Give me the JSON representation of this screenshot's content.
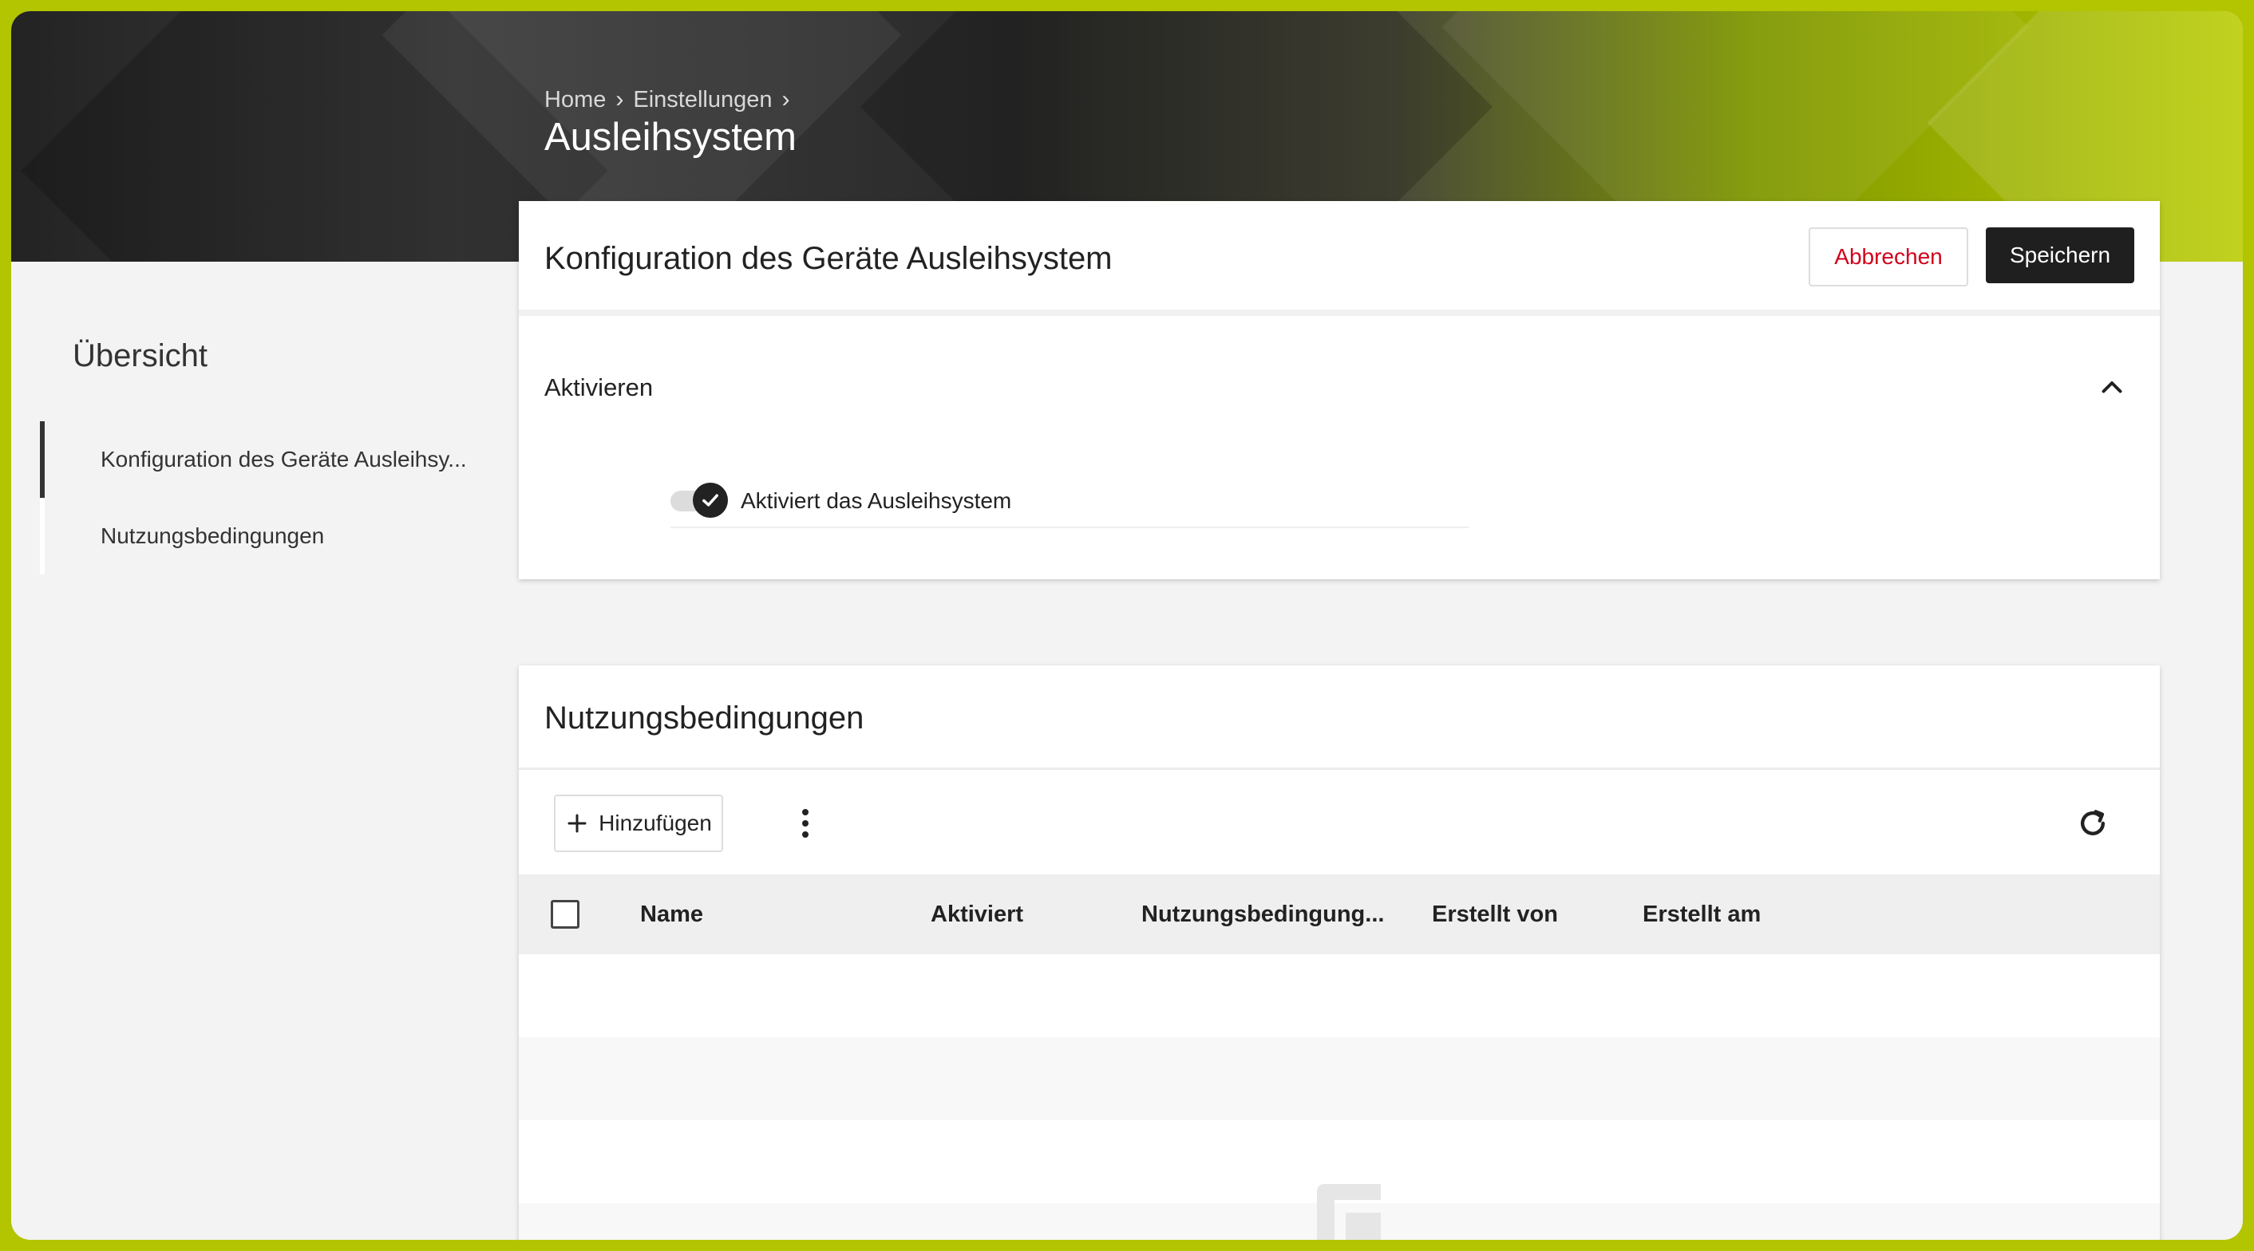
{
  "header": {
    "breadcrumb": [
      "Home",
      "Einstellungen"
    ],
    "title": "Ausleihsystem"
  },
  "sidebar": {
    "title": "Übersicht",
    "items": [
      {
        "label": "Konfiguration des Geräte Ausleihsy...",
        "active": true
      },
      {
        "label": "Nutzungsbedingungen",
        "active": false
      }
    ]
  },
  "config": {
    "title": "Konfiguration des Geräte Ausleihsystem",
    "cancel_label": "Abbrechen",
    "save_label": "Speichern",
    "section_label": "Aktivieren",
    "toggle_label": "Aktiviert das Ausleihsystem",
    "toggle_on": true
  },
  "terms": {
    "title": "Nutzungsbedingungen",
    "add_label": "Hinzufügen",
    "columns": [
      "Name",
      "Aktiviert",
      "Nutzungsbedingung...",
      "Erstellt von",
      "Erstellt am"
    ]
  },
  "colors": {
    "accent": "#b3c400",
    "cancel_text": "#d0021b",
    "save_bg": "#1f1f1f"
  }
}
